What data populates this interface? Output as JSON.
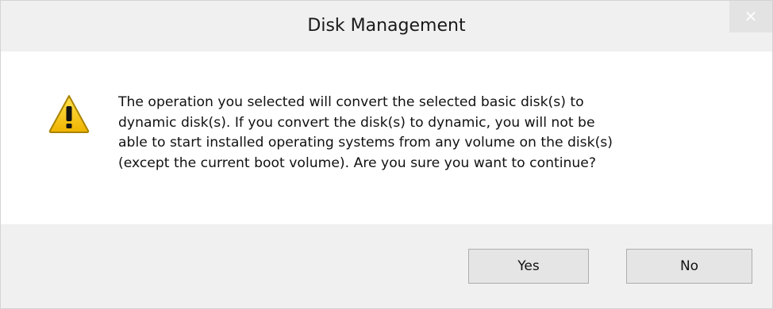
{
  "window": {
    "title": "Disk Management",
    "close_glyph": "×"
  },
  "message": {
    "icon": "warning-icon",
    "text": "The operation you selected will convert the selected basic disk(s) to\ndynamic disk(s). If you convert the disk(s) to dynamic, you will not be\nable to start installed operating systems from any volume on the disk(s)\n(except the current boot volume). Are you sure you want to continue?"
  },
  "buttons": {
    "yes_label": "Yes",
    "no_label": "No"
  },
  "colors": {
    "warning_yellow": "#f5c400",
    "warning_outline": "#b08a00",
    "dialog_background": "#f0f0f0",
    "content_background": "#ffffff"
  }
}
